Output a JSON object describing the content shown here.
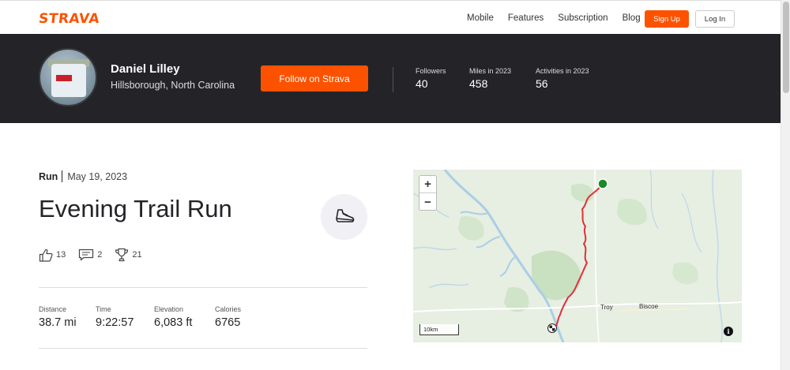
{
  "nav": {
    "logo": "STRAVA",
    "links": [
      "Mobile",
      "Features",
      "Subscription",
      "Blog"
    ],
    "signup": "Sign Up",
    "login": "Log In"
  },
  "athlete": {
    "name": "Daniel Lilley",
    "location": "Hillsborough, North Carolina",
    "follow_label": "Follow on Strava",
    "stats": [
      {
        "label": "Followers",
        "value": "40"
      },
      {
        "label": "Miles in 2023",
        "value": "458"
      },
      {
        "label": "Activities in 2023",
        "value": "56"
      }
    ]
  },
  "activity": {
    "type": "Run",
    "date": "May 19, 2023",
    "title": "Evening Trail Run",
    "sport_icon": "shoe-icon",
    "kudos": "13",
    "comments": "2",
    "achievements": "21",
    "metrics": [
      {
        "label": "Distance",
        "value": "38.7 mi"
      },
      {
        "label": "Time",
        "value": "9:22:57"
      },
      {
        "label": "Elevation",
        "value": "6,083 ft"
      },
      {
        "label": "Calories",
        "value": "6765"
      }
    ]
  },
  "map": {
    "zoom_in": "+",
    "zoom_out": "−",
    "scale": "10km",
    "info": "i",
    "places": [
      "Troy",
      "Biscoe"
    ],
    "route_color": "#e0303a",
    "start_color": "#1a8a2a"
  },
  "colors": {
    "brand": "#fc5200",
    "header_bg": "#242428"
  }
}
